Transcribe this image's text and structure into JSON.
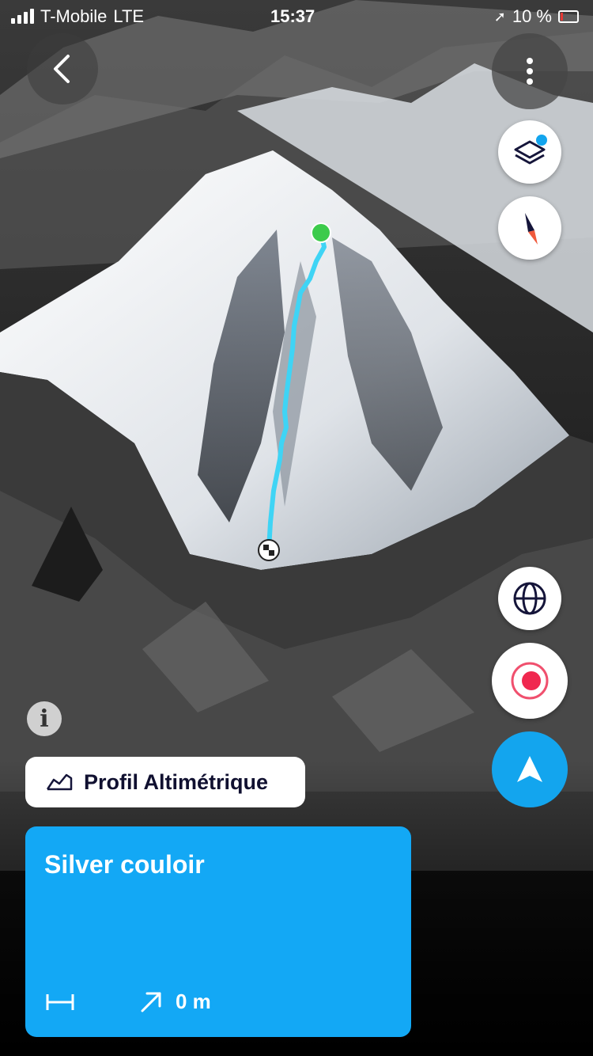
{
  "status_bar": {
    "carrier": "T-Mobile",
    "network": "LTE",
    "time": "15:37",
    "battery": "10 %"
  },
  "map": {
    "route_color": "#3fd4f5",
    "start_marker_color": "#3ccb4b"
  },
  "buttons": {
    "profile_label": "Profil Altimétrique",
    "info_label": "i"
  },
  "route_card": {
    "name": "Silver couloir",
    "elevation_gain": "0 m",
    "background": "#13a8f5"
  },
  "icons": [
    "back-icon",
    "more-icon",
    "layers-icon",
    "compass-icon",
    "globe-icon",
    "record-icon",
    "locate-arrow-icon",
    "info-icon",
    "elevation-profile-icon",
    "distance-icon",
    "elevation-gain-icon"
  ]
}
